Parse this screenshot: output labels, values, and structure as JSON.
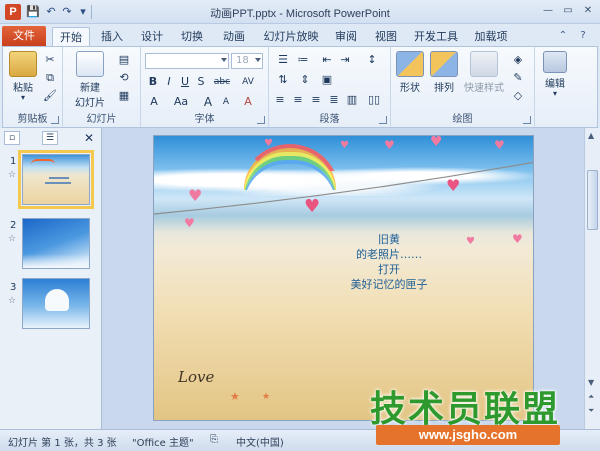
{
  "window": {
    "title": "动画PPT.pptx  -  Microsoft PowerPoint",
    "app_icon_letter": "P"
  },
  "qat": {
    "save": "💾",
    "undo": "↶",
    "redo": "↷",
    "customize": "▾"
  },
  "window_controls": {
    "minimize": "—",
    "restore": "▭",
    "close": "✕"
  },
  "tabs": {
    "file": "文件",
    "items": [
      "开始",
      "插入",
      "设计",
      "切换",
      "动画",
      "幻灯片放映",
      "审阅",
      "视图",
      "开发工具",
      "加载项"
    ],
    "active": "开始"
  },
  "ribbon": {
    "clipboard": {
      "label": "剪贴板",
      "paste": "粘贴"
    },
    "slides": {
      "label": "幻灯片",
      "new_slide_line1": "新建",
      "new_slide_line2": "幻灯片"
    },
    "font": {
      "label": "字体",
      "font_size": "18",
      "bold": "B",
      "italic": "I",
      "underline": "U",
      "strike": "S",
      "shadow": "abc",
      "spacing": "AV",
      "case": "Aa",
      "grow": "A",
      "shrink": "A",
      "clear": "A",
      "color": "A"
    },
    "paragraph": {
      "label": "段落"
    },
    "drawing": {
      "label": "绘图",
      "shapes": "形状",
      "arrange": "排列",
      "quick_styles": "快速样式"
    },
    "editing": {
      "label": "编辑",
      "edit": "编辑"
    }
  },
  "thumbnails": [
    {
      "number": "1",
      "star": "☆",
      "selected": true
    },
    {
      "number": "2",
      "star": "☆",
      "selected": false
    },
    {
      "number": "3",
      "star": "☆",
      "selected": false
    }
  ],
  "slide": {
    "lines": [
      "旧黄",
      "的老照片……",
      "打开",
      "美好记忆的匣子"
    ],
    "love_text": "Love"
  },
  "status": {
    "slide_info": "幻灯片 第 1 张，共 3 张",
    "theme": "\"Office 主题\"",
    "language": "中文(中国)"
  },
  "watermark": {
    "main": "技术员联盟",
    "url": "www.jsgho.com"
  },
  "colors": {
    "file_tab": "#d24726",
    "accent": "#2b579a",
    "watermark_green": "#2e9a2e",
    "watermark_orange": "#e6732b"
  }
}
